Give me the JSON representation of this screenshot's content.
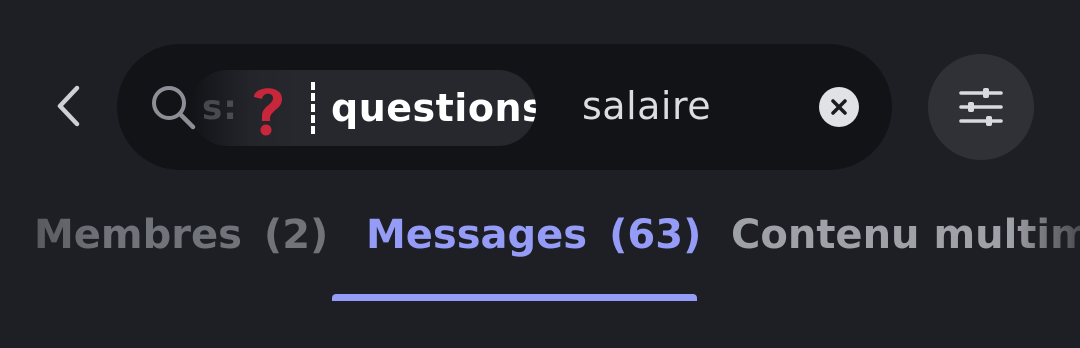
{
  "search": {
    "filter_chip": {
      "prefix": "s:",
      "emoji": "red-question-mark",
      "value": "questions"
    },
    "query": "salaire"
  },
  "icons": {
    "back": "chevron-left-icon",
    "search": "search-icon",
    "clear": "clear-icon",
    "filter": "sliders-icon"
  },
  "tabs": [
    {
      "label": "Membres",
      "count": "(2)",
      "active": false
    },
    {
      "label": "Messages",
      "count": "(63)",
      "active": true
    },
    {
      "label": "Contenu multimé",
      "count": "",
      "active": false
    }
  ],
  "colors": {
    "background": "#1e1f24",
    "search_bar": "#121317",
    "chip": "#26282e",
    "accent": "#949cf7",
    "emoji_red": "#c8263a"
  }
}
